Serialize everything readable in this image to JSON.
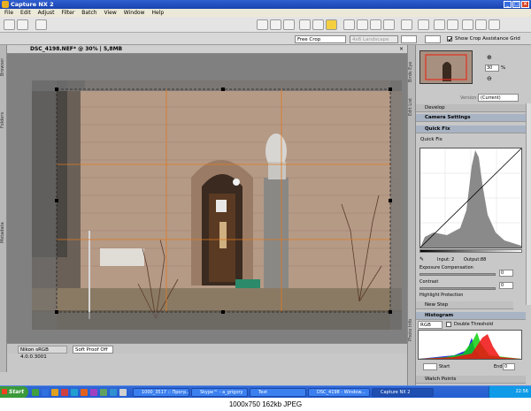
{
  "window": {
    "title": "Capture NX 2",
    "close": "×"
  },
  "menu": [
    "File",
    "Edit",
    "Adjust",
    "Filter",
    "Batch",
    "View",
    "Window",
    "Help"
  ],
  "crop": {
    "mode": "Free Crop",
    "ratio": "4x6 Landscape",
    "grid_label": "Show Crop Assistance Grid",
    "grid_checked": true
  },
  "document": {
    "tab": "DSC_4198.NEF* @ 30% | 5,8MB"
  },
  "left_tabs": [
    "Browser",
    "Folders",
    "Metadata"
  ],
  "status": {
    "profile": "Nikon sRGB 4.0.0.3001",
    "soft_proof": "Soft Proof Off"
  },
  "right_tabs": [
    "Birds Eye",
    "Edit List",
    "Photo Info"
  ],
  "birds_eye": {
    "zoom": "30",
    "unit": "%"
  },
  "edit_list": {
    "version_label": "Version:",
    "version_value": "(Current)",
    "develop": "Develop",
    "camera_settings": "Camera Settings",
    "quick_fix": "Quick Fix",
    "quick_fix_sub": "Quick Fix",
    "input_label": "Input:",
    "input_value": "2",
    "output_label": "Output:",
    "output_value": "88",
    "exposure": "Exposure Compensation",
    "exposure_value": "0",
    "contrast": "Contrast",
    "contrast_value": "0",
    "highlight": "Highlight Protection",
    "new_step": "New Step"
  },
  "histogram": {
    "title": "Histogram",
    "channel": "RGB",
    "double_threshold": "Double Threshold",
    "start": "Start",
    "end": "End",
    "end_value": "0"
  },
  "watch_points": "Watch Points",
  "taskbar": {
    "start": "Start",
    "tasks": [
      "1000_3517 :: Прогр...",
      "Skype™ - a_grigory",
      "Text",
      "DSC_4198 - Window...",
      "Capture NX 2"
    ],
    "active_task": "Capture NX 2",
    "time": "22:56"
  },
  "caption": "1000x750 162kb JPEG",
  "colors": {
    "title": "#2f5fd0",
    "taskbar": "#245dd0",
    "crop_guides": "#e07a20",
    "highlight": "#f4d040"
  }
}
